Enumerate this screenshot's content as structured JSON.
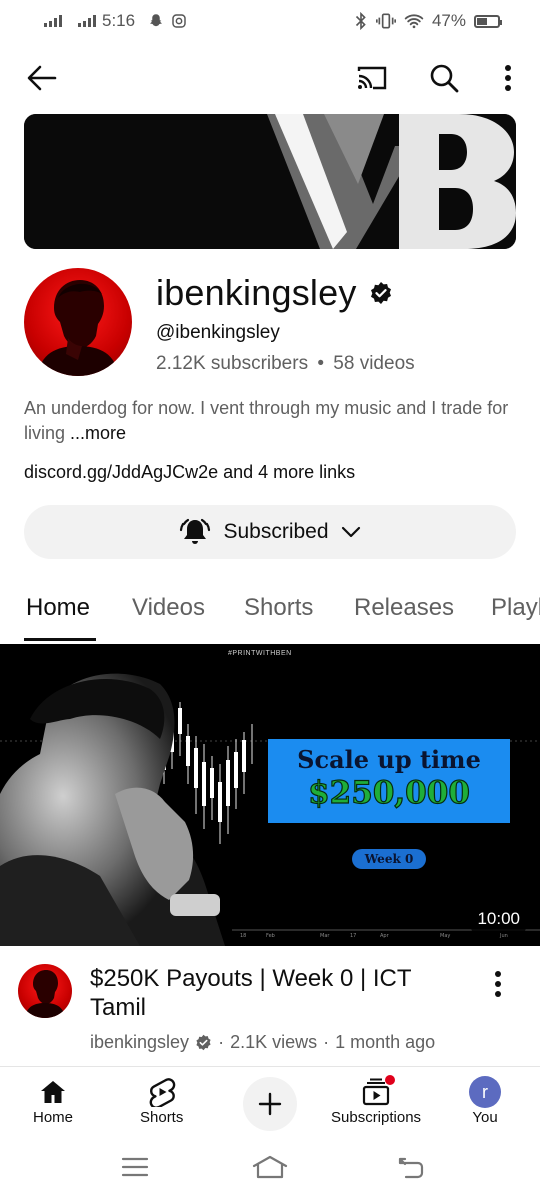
{
  "status_bar": {
    "time": "5:16",
    "battery": "47%"
  },
  "app_bar": {
    "back_icon": "arrow-left-icon",
    "cast_icon": "cast-icon",
    "search_icon": "search-icon",
    "more_icon": "kebab-menu-icon"
  },
  "channel": {
    "name": "ibenkingsley",
    "handle": "@ibenkingsley",
    "subscribers": "2.12K subscribers",
    "videos": "58 videos",
    "stats_separator": "•",
    "description": "An underdog for now. I vent through my music and I trade for living ",
    "more_label": "...more",
    "link": "discord.gg/JddAgJCw2e",
    "more_links": " and 4 more links",
    "subscribe_label": "Subscribed"
  },
  "tabs": [
    {
      "label": "Home",
      "active": true
    },
    {
      "label": "Videos"
    },
    {
      "label": "Shorts"
    },
    {
      "label": "Releases"
    },
    {
      "label": "Playlists"
    }
  ],
  "video": {
    "duration": "10:00",
    "thumb_overlay_title": "Scale up time",
    "thumb_overlay_amount": "$250,000",
    "thumb_week": "Week 0",
    "thumb_small_label": "#PRINTWITHBEN",
    "title": "$250K Payouts | Week 0 | ICT Tamil",
    "channel": "ibenkingsley",
    "views": "2.1K views",
    "age": "1 month ago",
    "meta_separator": "·"
  },
  "bottom_nav": [
    {
      "label": "Home",
      "icon": "home-icon"
    },
    {
      "label": "Shorts",
      "icon": "shorts-icon"
    },
    {
      "label": "",
      "icon": "create-plus-icon"
    },
    {
      "label": "Subscriptions",
      "icon": "subscriptions-icon"
    },
    {
      "label": "You",
      "icon": "account-avatar",
      "avatar_letter": "r"
    }
  ],
  "colors": {
    "accent_red": "#cc0000",
    "text_primary": "#0f0f0f",
    "text_secondary": "#606060",
    "avatar_blue": "#5c6bc0"
  }
}
